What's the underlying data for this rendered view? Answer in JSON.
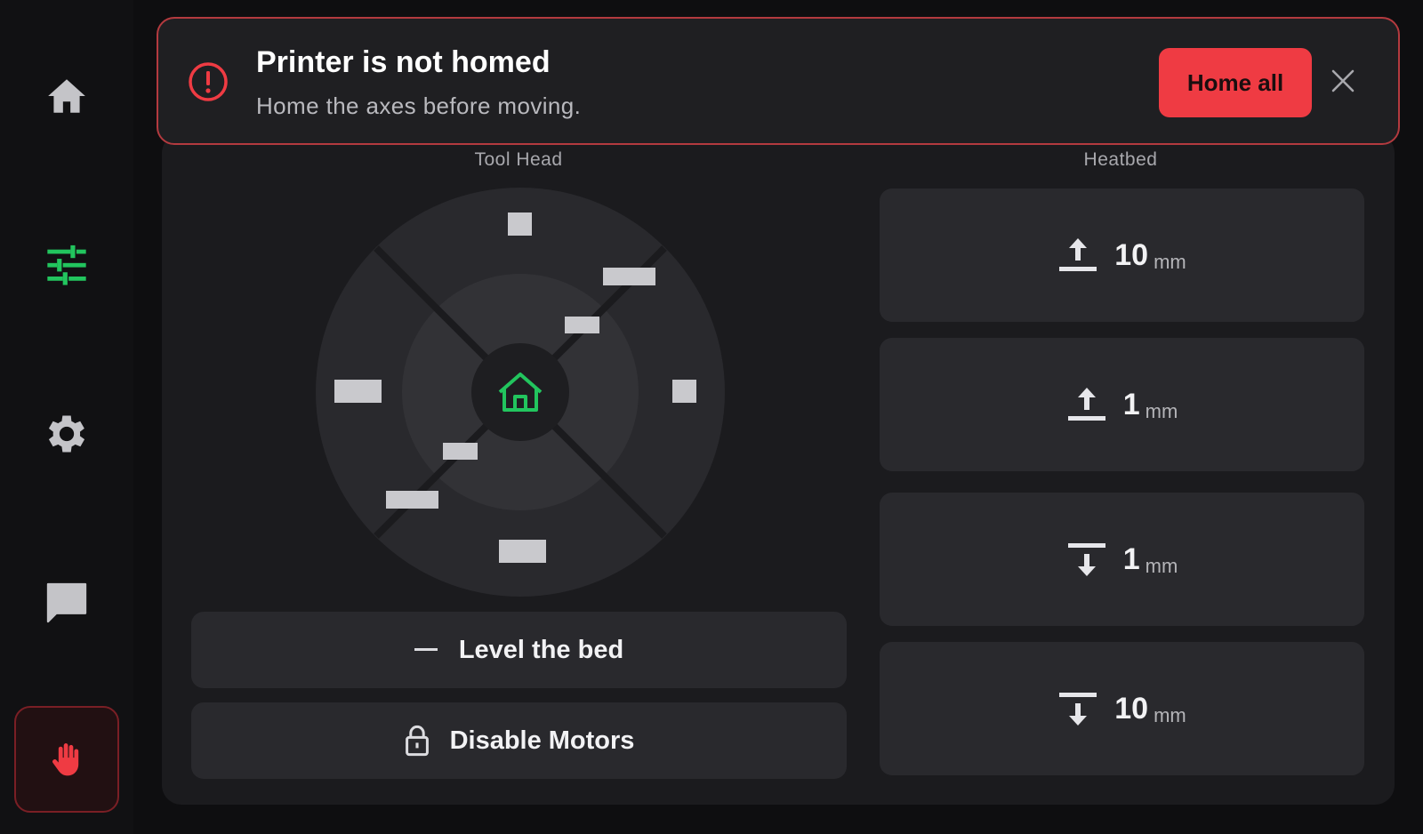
{
  "alert": {
    "title": "Printer is not homed",
    "message": "Home the axes before moving.",
    "action_label": "Home all",
    "color": "#ef3b43"
  },
  "sidebar": {
    "items": [
      {
        "icon": "home-icon",
        "active": false
      },
      {
        "icon": "sliders-icon",
        "active": true,
        "color": "#22c55e"
      },
      {
        "icon": "gear-icon",
        "active": false
      },
      {
        "icon": "chat-icon",
        "active": false
      },
      {
        "icon": "hand-stop-icon",
        "active": false,
        "color": "#ef3b43"
      }
    ]
  },
  "toolhead": {
    "label": "Tool Head",
    "center_icon": "home-outline-icon"
  },
  "heatbed": {
    "label": "Heatbed",
    "buttons": [
      {
        "direction": "up",
        "value": "10",
        "unit": "mm"
      },
      {
        "direction": "up",
        "value": "1",
        "unit": "mm"
      },
      {
        "direction": "down",
        "value": "1",
        "unit": "mm"
      },
      {
        "direction": "down",
        "value": "10",
        "unit": "mm"
      }
    ]
  },
  "actions": {
    "level_label": "Level the bed",
    "disable_label": "Disable Motors"
  }
}
